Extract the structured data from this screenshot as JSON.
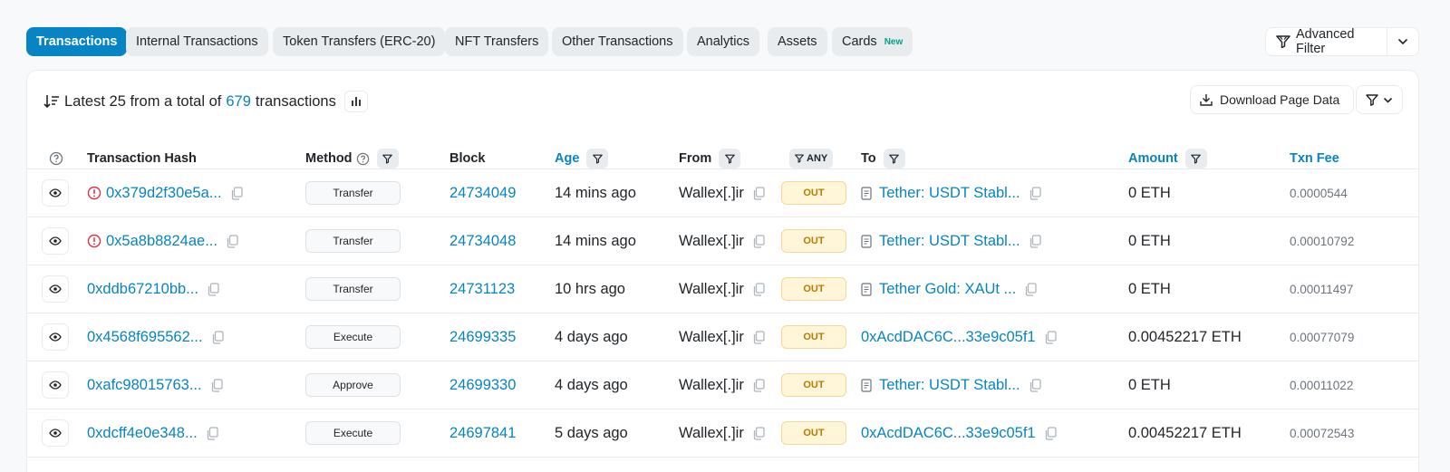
{
  "tabs": [
    {
      "label": "Transactions",
      "active": true
    },
    {
      "label": "Internal Transactions"
    },
    {
      "label": "Token Transfers (ERC-20)"
    },
    {
      "label": "NFT Transfers"
    },
    {
      "label": "Other Transactions"
    },
    {
      "label": "Analytics"
    },
    {
      "label": "Assets"
    },
    {
      "label": "Cards",
      "badge": "New"
    }
  ],
  "advanced_filter": {
    "label": "Advanced Filter"
  },
  "summary": {
    "prefix": "Latest 25 from a total of",
    "count": "679",
    "suffix": "transactions"
  },
  "download": {
    "label": "Download Page Data"
  },
  "columns": {
    "hash": "Transaction Hash",
    "method": "Method",
    "block": "Block",
    "age": "Age",
    "from": "From",
    "any": "ANY",
    "to": "To",
    "amount": "Amount",
    "fee": "Txn Fee"
  },
  "rows": [
    {
      "error": true,
      "hash": "0x379d2f30e5a...",
      "method": "Transfer",
      "block": "24734049",
      "age": "14 mins ago",
      "from": "Wallex[.]ir",
      "direction": "OUT",
      "to": "Tether: USDT Stabl...",
      "to_contract": true,
      "amount": "0 ETH",
      "fee": "0.0000544"
    },
    {
      "error": true,
      "hash": "0x5a8b8824ae...",
      "method": "Transfer",
      "block": "24734048",
      "age": "14 mins ago",
      "from": "Wallex[.]ir",
      "direction": "OUT",
      "to": "Tether: USDT Stabl...",
      "to_contract": true,
      "amount": "0 ETH",
      "fee": "0.00010792"
    },
    {
      "error": false,
      "hash": "0xddb67210bb...",
      "method": "Transfer",
      "block": "24731123",
      "age": "10 hrs ago",
      "from": "Wallex[.]ir",
      "direction": "OUT",
      "to": "Tether Gold: XAUt ...",
      "to_contract": true,
      "amount": "0 ETH",
      "fee": "0.00011497"
    },
    {
      "error": false,
      "hash": "0x4568f695562...",
      "method": "Execute",
      "block": "24699335",
      "age": "4 days ago",
      "from": "Wallex[.]ir",
      "direction": "OUT",
      "to": "0xAcdDAC6C...33e9c05f1",
      "to_contract": false,
      "amount": "0.00452217 ETH",
      "fee": "0.00077079"
    },
    {
      "error": false,
      "hash": "0xafc98015763...",
      "method": "Approve",
      "block": "24699330",
      "age": "4 days ago",
      "from": "Wallex[.]ir",
      "direction": "OUT",
      "to": "Tether: USDT Stabl...",
      "to_contract": true,
      "amount": "0 ETH",
      "fee": "0.00011022"
    },
    {
      "error": false,
      "hash": "0xdcff4e0e348...",
      "method": "Execute",
      "block": "24697841",
      "age": "5 days ago",
      "from": "Wallex[.]ir",
      "direction": "OUT",
      "to": "0xAcdDAC6C...33e9c05f1",
      "to_contract": false,
      "amount": "0.00452217 ETH",
      "fee": "0.00072543"
    }
  ],
  "colors": {
    "accent": "#0784c3",
    "error": "#dc3545",
    "out_badge": "#b47d00"
  }
}
